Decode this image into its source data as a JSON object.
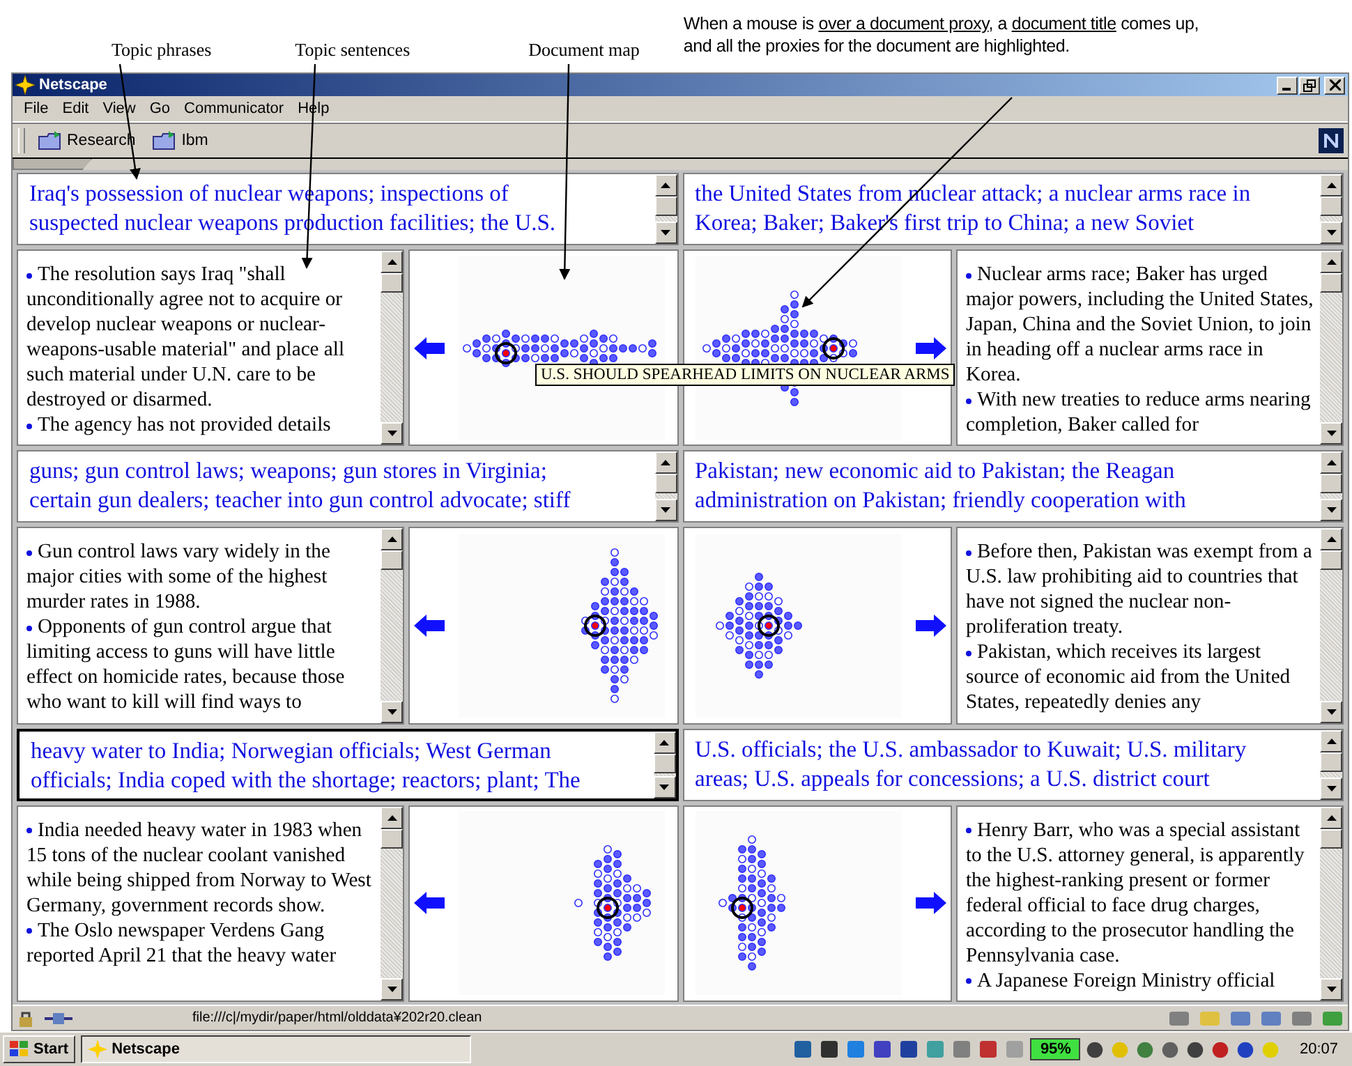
{
  "annotations": {
    "labels": [
      "Topic phrases",
      "Topic sentences",
      "Document map"
    ],
    "note": [
      [
        {
          "text": "When a mouse is ",
          "underlined": false
        },
        {
          "text": "over a document proxy",
          "underlined": true
        },
        {
          "text": ", a ",
          "underlined": false
        },
        {
          "text": "document title",
          "underlined": true
        },
        {
          "text": " comes up,",
          "underlined": false
        }
      ],
      [
        {
          "text": "and all the proxies for the document are highlighted.",
          "underlined": false
        }
      ]
    ]
  },
  "window": {
    "title": "Netscape",
    "menu": [
      "File",
      "Edit",
      "View",
      "Go",
      "Communicator",
      "Help"
    ],
    "bookmarks": [
      "Research",
      "Ibm"
    ]
  },
  "panels": [
    {
      "kind": "left",
      "selected": false,
      "topics": [
        "Iraq's possession of nuclear weapons; inspections of",
        "suspected nuclear weapons production facilities; the U.S."
      ],
      "sentences": [
        "The resolution says Iraq \"shall unconditionally agree not to acquire or develop nuclear weapons or nuclear-weapons-usable material\" and place all such material under U.N. care to be destroyed or disarmed.",
        "The agency has not provided details"
      ]
    },
    {
      "kind": "right",
      "selected": false,
      "topics": [
        "the United States from nuclear attack; a nuclear arms race in",
        "Korea; Baker; Baker's first trip to China; a new Soviet"
      ],
      "sentences": [
        "Nuclear arms race; Baker has urged major powers, including the United States, Japan, China and the Soviet Union, to join in heading off a nuclear arms race in Korea.",
        "With new treaties to reduce arms nearing completion, Baker called for"
      ]
    },
    {
      "kind": "left",
      "selected": false,
      "topics": [
        "guns; gun control laws; weapons; gun stores in Virginia;",
        "certain gun dealers; teacher into gun control advocate; stiff"
      ],
      "sentences": [
        "Gun control laws vary widely in the major cities with some of the highest murder rates in 1988.",
        "Opponents of gun control argue that limiting access to guns will have little effect on homicide rates, because those who want to kill will find ways to"
      ]
    },
    {
      "kind": "right",
      "selected": false,
      "topics": [
        "Pakistan; new economic aid to Pakistan; the Reagan",
        "administration on Pakistan; friendly cooperation with"
      ],
      "sentences": [
        "Before then, Pakistan was exempt from a U.S. law prohibiting aid to countries that have not signed the nuclear non-proliferation treaty.",
        "Pakistan, which receives its largest source of economic aid from the United States, repeatedly denies any"
      ]
    },
    {
      "kind": "left",
      "selected": true,
      "topics": [
        "heavy water to India; Norwegian officials; West German",
        "officials; India coped with the shortage; reactors; plant; The"
      ],
      "sentences": [
        "India needed heavy water in 1983 when 15 tons of the nuclear coolant vanished while being shipped from Norway to West Germany, government records show.",
        "The Oslo newspaper Verdens Gang reported April 21 that the heavy water"
      ]
    },
    {
      "kind": "right",
      "selected": false,
      "topics": [
        "U.S. officials; the U.S. ambassador to Kuwait; U.S. military",
        "areas; U.S. appeals for concessions; a U.S. district court"
      ],
      "sentences": [
        "Henry Barr, who was a special assistant to the U.S. attorney general, is apparently the highest-ranking present or former federal official to face drug charges, according to the prosecutor handling the Pennsylvania case.",
        "A Japanese Foreign Ministry official"
      ]
    }
  ],
  "tooltip": "U.S. SHOULD SPEARHEAD LIMITS ON NUCLEAR ARMS",
  "status_bar": {
    "url": "file:///c|/mydir/paper/html/olddata¥202r20.clean"
  },
  "taskbar": {
    "start": "Start",
    "tasks": [
      "Netscape"
    ],
    "battery": "95%",
    "clock": "20:07"
  }
}
